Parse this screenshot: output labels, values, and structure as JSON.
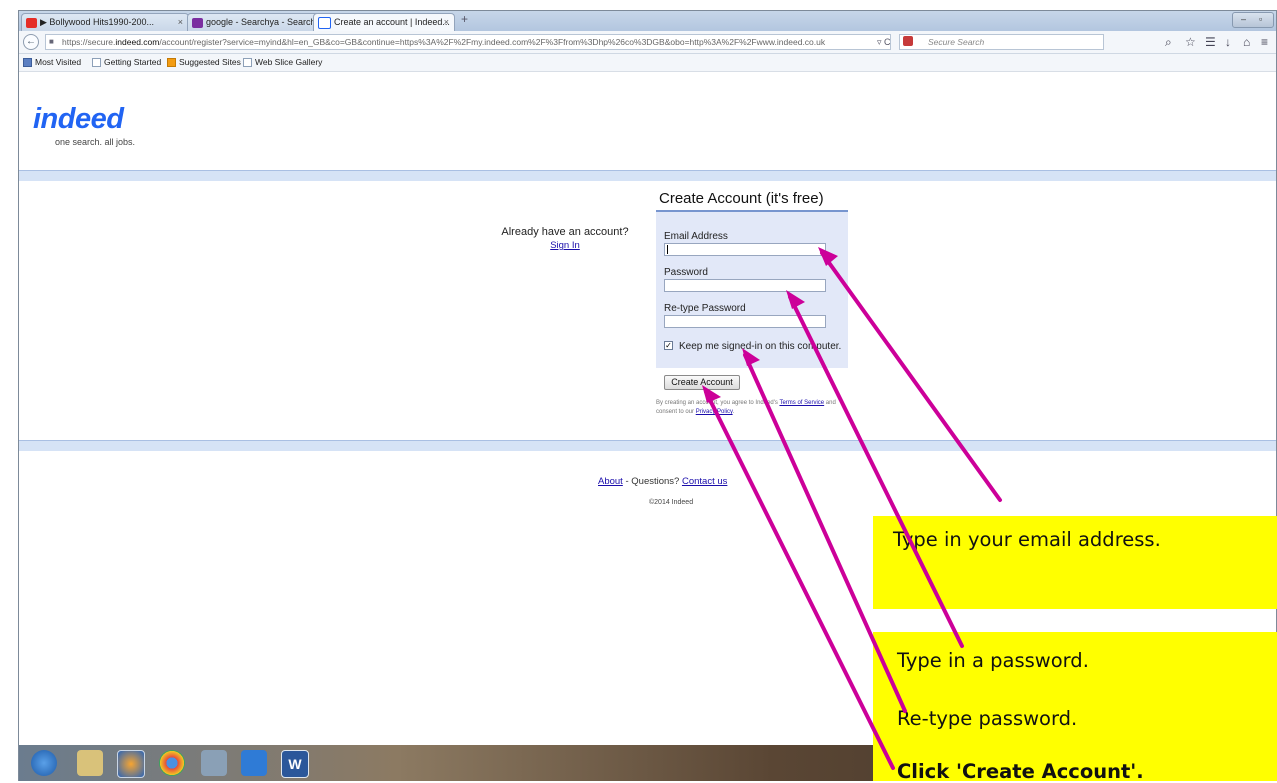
{
  "browser": {
    "tabs": [
      {
        "label": "▶ Bollywood Hits1990-200...",
        "close": "×",
        "icon_color": "#e52d27"
      },
      {
        "label": "google - Searchya - Search...",
        "close": "×",
        "icon_color": "#7b2ea0"
      },
      {
        "label": "Create an account | Indeed...",
        "close": "×",
        "icon_color": "#2164f3"
      }
    ],
    "new_tab": "+",
    "window_buttons": {
      "minimize": "–",
      "restore": "▫"
    },
    "url_prefix": "https://secure.",
    "url_domain": "indeed.com",
    "url_rest": "/account/register?service=myind&hl=en_GB&co=GB&continue=https%3A%2F%2Fmy.indeed.com%2F%3Ffrom%3Dhp%26co%3DGB&obo=http%3A%2F%2Fwww.indeed.co.uk",
    "search_placeholder": "Secure Search",
    "icons": {
      "back": "←",
      "lock": "🔒",
      "reload": "▿ C",
      "search": "⌕",
      "star": "☆",
      "reader": "☰",
      "download": "↓",
      "home": "⌂",
      "menu": "≡"
    },
    "bookmarks": [
      "Most Visited",
      "Getting Started",
      "Suggested Sites",
      "Web Slice Gallery"
    ]
  },
  "page": {
    "logo": "indeed",
    "logo_tagline": "one search. all jobs.",
    "already_text": "Already have an account?",
    "sign_in": "Sign In",
    "form_title": "Create Account (it's free)",
    "email_label": "Email Address",
    "password_label": "Password",
    "retype_label": "Re-type Password",
    "keep_signed_in": "Keep me signed-in on this computer.",
    "checkbox_mark": "✓",
    "create_button": "Create Account",
    "terms_prefix": "By creating an account, you agree to Indeed's ",
    "terms_link": "Terms of Service",
    "terms_mid": " and consent to our ",
    "privacy_link": "Privacy Policy",
    "terms_end": ".",
    "footer_about": "About",
    "footer_questions": " - Questions? ",
    "footer_contact": "Contact us",
    "copyright": "©2014 Indeed"
  },
  "callouts": {
    "email": "Type in your email address.",
    "password": "Type in a password.",
    "retype": "Re-type password.",
    "create": "Click 'Create Account'."
  },
  "colors": {
    "arrow": "#cc0099",
    "callout_bg": "#ffff00",
    "indeed_blue": "#2164f3"
  }
}
